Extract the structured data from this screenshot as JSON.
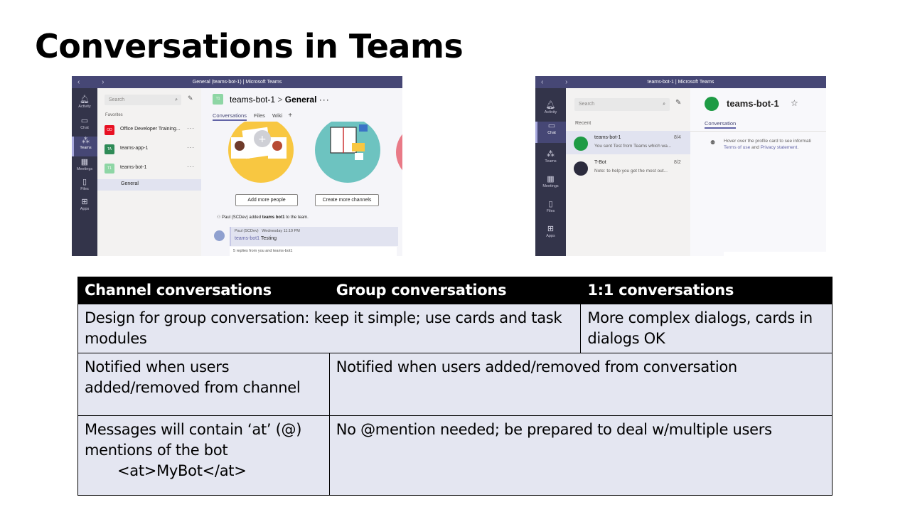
{
  "slide": {
    "title": "Conversations in Teams"
  },
  "screenshot_channel": {
    "window_title": "General (teams-bot-1) | Microsoft Teams",
    "rail": [
      "Activity",
      "Chat",
      "Teams",
      "Meetings",
      "Files",
      "Apps"
    ],
    "search_placeholder": "Search",
    "favorites_label": "Favorites",
    "teams": [
      {
        "initials": "OD",
        "name": "Office Developer Training...",
        "color": "#e81123"
      },
      {
        "initials": "TA",
        "name": "teams-app-1",
        "color": "#2e8b57"
      },
      {
        "initials": "T1",
        "name": "teams-bot-1",
        "color": "#8ed6a5"
      }
    ],
    "channel": "General",
    "header_team": "teams-bot-1",
    "header_sep": ">",
    "header_channel": "General",
    "header_initials": "T1",
    "tabs": [
      "Conversations",
      "Files",
      "Wiki",
      "+"
    ],
    "add_people_button": "Add more people",
    "create_channels_button": "Create more channels",
    "system_msg_prefix": "Paul (SCDev) added ",
    "system_msg_bold": "teams bot1",
    "system_msg_suffix": " to the team.",
    "message_meta": "Paul (SCDev)   Wednesday 11:19 PM",
    "message_mention": "teams-bot1",
    "message_text": " Testing",
    "replies_text": "5 replies from you and teams-bot1"
  },
  "screenshot_chat": {
    "window_title": "teams-bot-1 | Microsoft Teams",
    "rail": [
      "Activity",
      "Chat",
      "Teams",
      "Meetings",
      "Files",
      "Apps"
    ],
    "search_placeholder": "Search",
    "recent_label": "Recent",
    "chats": [
      {
        "name": "teams-bot-1",
        "date": "8/4",
        "preview": "You sent Test from Teams which wa..."
      },
      {
        "name": "T-Bot",
        "date": "8/2",
        "preview": "Note: to help you get the most out..."
      }
    ],
    "header_name": "teams-bot-1",
    "tab": "Conversation",
    "hover_line1": "Hover over the profile card to see informati",
    "hover_line2_a": "Terms of use",
    "hover_line2_b": " and ",
    "hover_line2_c": "Privacy statement",
    "hover_line2_d": "."
  },
  "table": {
    "headers": [
      "Channel conversations",
      "Group conversations",
      "1:1 conversations"
    ],
    "row1_span": "Design for group conversation: keep it simple; use cards and task modules",
    "row1_right": "More complex dialogs, cards in dialogs OK",
    "row2_left": "Notified when users added/removed from channel",
    "row2_right": "Notified when users added/removed from conversation",
    "row3_left": "Messages will contain ‘at’ (@) mentions of the bot",
    "row3_code": "<at>MyBot</at>",
    "row3_right": "No @mention needed; be prepared to deal w/multiple users"
  }
}
